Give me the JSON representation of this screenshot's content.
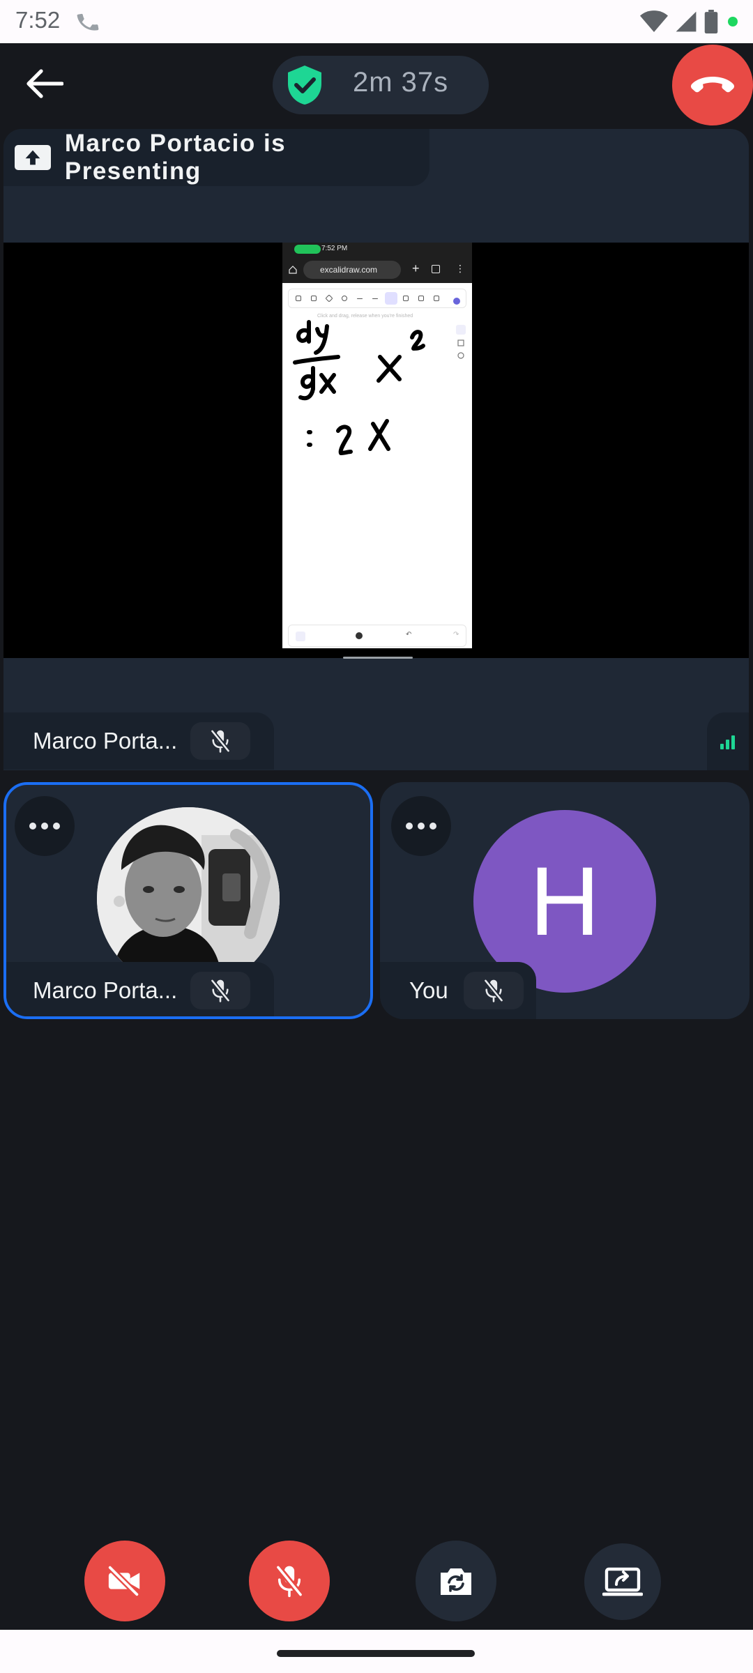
{
  "status_bar": {
    "time": "7:52",
    "icons": [
      "call-icon",
      "wifi-icon",
      "cellular-signal-icon",
      "battery-icon",
      "privacy-indicator-dot"
    ]
  },
  "call_bar": {
    "back_icon": "arrow-back-icon",
    "security_icon": "shield-check-icon",
    "duration": "2m 37s",
    "hangup_icon": "phone-hangup-icon"
  },
  "presentation": {
    "label": "Marco Portacio is Presenting",
    "presenter_name": "Marco Porta...",
    "shared_screen": {
      "time": "7:52 PM",
      "url": "excalidraw.com",
      "hint": "Click and drag, release when you're finished"
    }
  },
  "participants": [
    {
      "name": "Marco Porta...",
      "avatar": "photo",
      "active": true
    },
    {
      "name": "You",
      "avatar_letter": "H",
      "avatar_color": "#7e57c2",
      "active": false
    }
  ],
  "controls": [
    {
      "name": "camera-off",
      "icon": "video-off-icon",
      "color": "#e84a45"
    },
    {
      "name": "mic-off",
      "icon": "mic-off-icon",
      "color": "#e84a45"
    },
    {
      "name": "switch-camera",
      "icon": "flip-camera-icon",
      "color": "#232b37"
    },
    {
      "name": "share-screen",
      "icon": "screen-share-icon",
      "color": "#232b37"
    }
  ],
  "colors": {
    "background": "#16181d",
    "tile": "#1f2835",
    "active_border": "#1b6ef3",
    "danger": "#e84a45",
    "secure": "#1ed694"
  }
}
